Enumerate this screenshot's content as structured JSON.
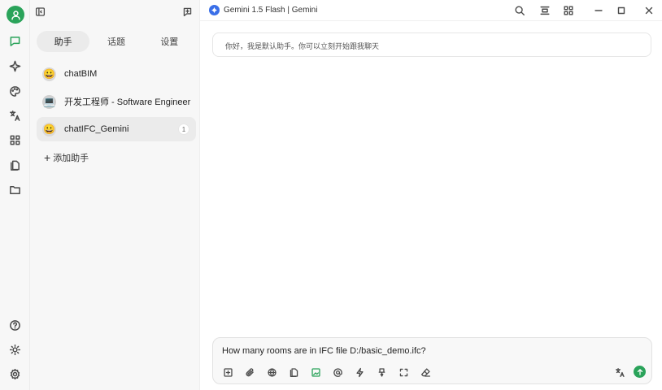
{
  "window": {
    "model_label": "Gemini 1.5 Flash | Gemini"
  },
  "sidebar": {
    "tabs": [
      {
        "label": "助手",
        "active": true
      },
      {
        "label": "话题",
        "active": false
      },
      {
        "label": "设置",
        "active": false
      }
    ],
    "assistants": [
      {
        "name": "chatBIM",
        "icon": "face-emoji",
        "active": false,
        "badge": ""
      },
      {
        "name": "开发工程师 - Software Engineer",
        "icon": "laptop-emoji",
        "active": false,
        "badge": ""
      },
      {
        "name": "chatIFC_Gemini",
        "icon": "face-emoji",
        "active": true,
        "badge": "1"
      }
    ],
    "add_label": "添加助手"
  },
  "chat": {
    "welcome": "你好，我是默认助手。你可以立刻开始跟我聊天"
  },
  "composer": {
    "input_value": "How many rooms are in IFC file D:/basic_demo.ifc?"
  },
  "colors": {
    "accent": "#2aa35a",
    "model_icon": "#3a6fe8"
  }
}
